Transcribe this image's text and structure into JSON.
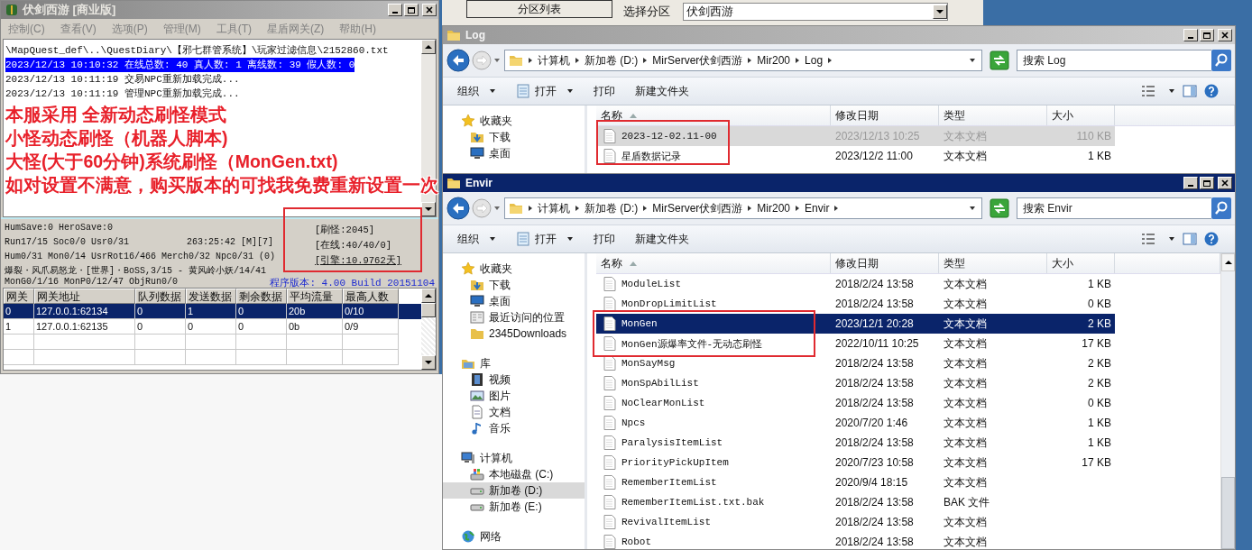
{
  "server_window": {
    "title": "伏剑西游 [商业版]",
    "active": false,
    "menu": [
      "控制(C)",
      "查看(V)",
      "选项(P)",
      "管理(M)",
      "工具(T)",
      "星盾网关(Z)",
      "帮助(H)"
    ],
    "log_lines": [
      {
        "text": "\\MapQuest_def\\..\\QuestDiary\\【邪七群管系统】\\玩家过滤信息\\2152860.txt",
        "selected": false
      },
      {
        "text": "2023/12/13 10:10:32 在线总数: 40 真人数: 1 离线数: 39 假人数: 0",
        "selected": true
      },
      {
        "text": "2023/12/13 10:11:19 交易NPC重新加载完成...",
        "selected": false
      },
      {
        "text": "2023/12/13 10:11:19 管理NPC重新加载完成...",
        "selected": false
      }
    ],
    "status_lines": [
      "HumSave:0 HeroSave:0",
      "Run17/15 Soc0/0 Usr0/31",
      "Hum0/31 Mon0/14 UsrRot16/466 Merch0/32 Npc0/31 (0)",
      "爆裂・风爪易怒龙・[世界]・BoSS,3/15 - 黄风岭小妖/14/41",
      "MonG0/1/16 MonP0/12/47 ObjRun0/0"
    ],
    "uptime": "263:25:42 [M][7]",
    "counters": [
      {
        "text": "[刷怪:2045]",
        "link": false
      },
      {
        "text": "[在线:40/40/0]",
        "link": false
      },
      {
        "text": "[引擎:10.9762天]",
        "link": true
      }
    ],
    "version": "程序版本: 4.00 Build 20151104",
    "gateway_table": {
      "columns": [
        "网关",
        "网关地址",
        "队列数据",
        "发送数据",
        "剩余数据",
        "平均流量",
        "最高人数"
      ],
      "rows": [
        {
          "cells": [
            "0",
            "127.0.0.1:62134",
            "0",
            "1",
            "0",
            "20b",
            "0/10"
          ],
          "selected": true
        },
        {
          "cells": [
            "1",
            "127.0.0.1:62135",
            "0",
            "0",
            "0",
            "0b",
            "0/9"
          ],
          "selected": false
        }
      ]
    }
  },
  "annotation": {
    "lines": [
      "本服采用 全新动态刷怪模式",
      "小怪动态刷怪（机器人脚本)",
      "大怪(大于60分钟)系统刷怪（MonGen.txt)",
      "如对设置不满意，购买版本的可找我免费重新设置一次"
    ]
  },
  "partition_dialog": {
    "list_header": "分区列表",
    "label": "选择分区",
    "value": "伏剑西游"
  },
  "explorers": [
    {
      "title": "Log",
      "active": false,
      "scrollbar": false,
      "path": [
        "计算机",
        "新加卷 (D:)",
        "MirServer伏剑西游",
        "Mir200",
        "Log"
      ],
      "search_placeholder": "搜索 Log",
      "toolbar": [
        {
          "label": "组织",
          "menu": true,
          "icon": false
        },
        {
          "label": "打开",
          "menu": true,
          "icon": true
        },
        {
          "label": "打印",
          "menu": false,
          "icon": false
        },
        {
          "label": "新建文件夹",
          "menu": false,
          "icon": false
        }
      ],
      "columns": [
        "名称",
        "修改日期",
        "类型",
        "大小"
      ],
      "nav": [
        {
          "label": "收藏夹",
          "kind": "favorites",
          "selected": false,
          "children": [
            {
              "label": "下载",
              "kind": "downloads",
              "selected": false
            },
            {
              "label": "桌面",
              "kind": "desktop",
              "selected": false
            }
          ]
        }
      ],
      "files": [
        {
          "name": "2023-12-02.11-00",
          "modified": "2023/12/13 10:25",
          "type": "文本文档",
          "size": "110 KB",
          "selected": true
        },
        {
          "name": "星盾数据记录",
          "modified": "2023/12/2 11:00",
          "type": "文本文档",
          "size": "1 KB",
          "selected": false
        }
      ]
    },
    {
      "title": "Envir",
      "active": true,
      "scrollbar": true,
      "path": [
        "计算机",
        "新加卷 (D:)",
        "MirServer伏剑西游",
        "Mir200",
        "Envir"
      ],
      "search_placeholder": "搜索 Envir",
      "toolbar": [
        {
          "label": "组织",
          "menu": true,
          "icon": false
        },
        {
          "label": "打开",
          "menu": true,
          "icon": true
        },
        {
          "label": "打印",
          "menu": false,
          "icon": false
        },
        {
          "label": "新建文件夹",
          "menu": false,
          "icon": false
        }
      ],
      "columns": [
        "名称",
        "修改日期",
        "类型",
        "大小"
      ],
      "nav": [
        {
          "label": "收藏夹",
          "kind": "favorites",
          "selected": false,
          "children": [
            {
              "label": "下载",
              "kind": "downloads",
              "selected": false
            },
            {
              "label": "桌面",
              "kind": "desktop",
              "selected": false
            },
            {
              "label": "最近访问的位置",
              "kind": "recent",
              "selected": false
            },
            {
              "label": "2345Downloads",
              "kind": "folder",
              "selected": false
            }
          ]
        },
        {
          "label": "库",
          "kind": "library",
          "selected": false,
          "children": [
            {
              "label": "视频",
              "kind": "video",
              "selected": false
            },
            {
              "label": "图片",
              "kind": "pictures",
              "selected": false
            },
            {
              "label": "文档",
              "kind": "documents",
              "selected": false
            },
            {
              "label": "音乐",
              "kind": "music",
              "selected": false
            }
          ]
        },
        {
          "label": "计算机",
          "kind": "computer",
          "selected": false,
          "children": [
            {
              "label": "本地磁盘 (C:)",
              "kind": "system-drive",
              "selected": false
            },
            {
              "label": "新加卷 (D:)",
              "kind": "drive",
              "selected": true
            },
            {
              "label": "新加卷 (E:)",
              "kind": "drive",
              "selected": false
            }
          ]
        },
        {
          "label": "网络",
          "kind": "network",
          "selected": false
        }
      ],
      "files": [
        {
          "name": "ModuleList",
          "modified": "2018/2/24 13:58",
          "type": "文本文档",
          "size": "1 KB",
          "selected": false
        },
        {
          "name": "MonDropLimitList",
          "modified": "2018/2/24 13:58",
          "type": "文本文档",
          "size": "0 KB",
          "selected": false
        },
        {
          "name": "MonGen",
          "modified": "2023/12/1 20:28",
          "type": "文本文档",
          "size": "2 KB",
          "selected": true
        },
        {
          "name": "MonGen源爆率文件-无动态刷怪",
          "modified": "2022/10/11 10:25",
          "type": "文本文档",
          "size": "17 KB",
          "selected": false
        },
        {
          "name": "MonSayMsg",
          "modified": "2018/2/24 13:58",
          "type": "文本文档",
          "size": "2 KB",
          "selected": false
        },
        {
          "name": "MonSpAbilList",
          "modified": "2018/2/24 13:58",
          "type": "文本文档",
          "size": "2 KB",
          "selected": false
        },
        {
          "name": "NoClearMonList",
          "modified": "2018/2/24 13:58",
          "type": "文本文档",
          "size": "0 KB",
          "selected": false
        },
        {
          "name": "Npcs",
          "modified": "2020/7/20 1:46",
          "type": "文本文档",
          "size": "1 KB",
          "selected": false
        },
        {
          "name": "ParalysisItemList",
          "modified": "2018/2/24 13:58",
          "type": "文本文档",
          "size": "1 KB",
          "selected": false
        },
        {
          "name": "PriorityPickUpItem",
          "modified": "2020/7/23 10:58",
          "type": "文本文档",
          "size": "17 KB",
          "selected": false
        },
        {
          "name": "RememberItemList",
          "modified": "2020/9/4 18:15",
          "type": "文本文档",
          "selected": false
        },
        {
          "name": "RememberItemList.txt.bak",
          "modified": "2018/2/24 13:58",
          "type": "BAK 文件",
          "selected": false
        },
        {
          "name": "RevivalItemList",
          "modified": "2018/2/24 13:58",
          "type": "文本文档",
          "selected": false
        },
        {
          "name": "Robot",
          "modified": "2018/2/24 13:58",
          "type": "文本文档",
          "selected": false
        }
      ]
    }
  ]
}
